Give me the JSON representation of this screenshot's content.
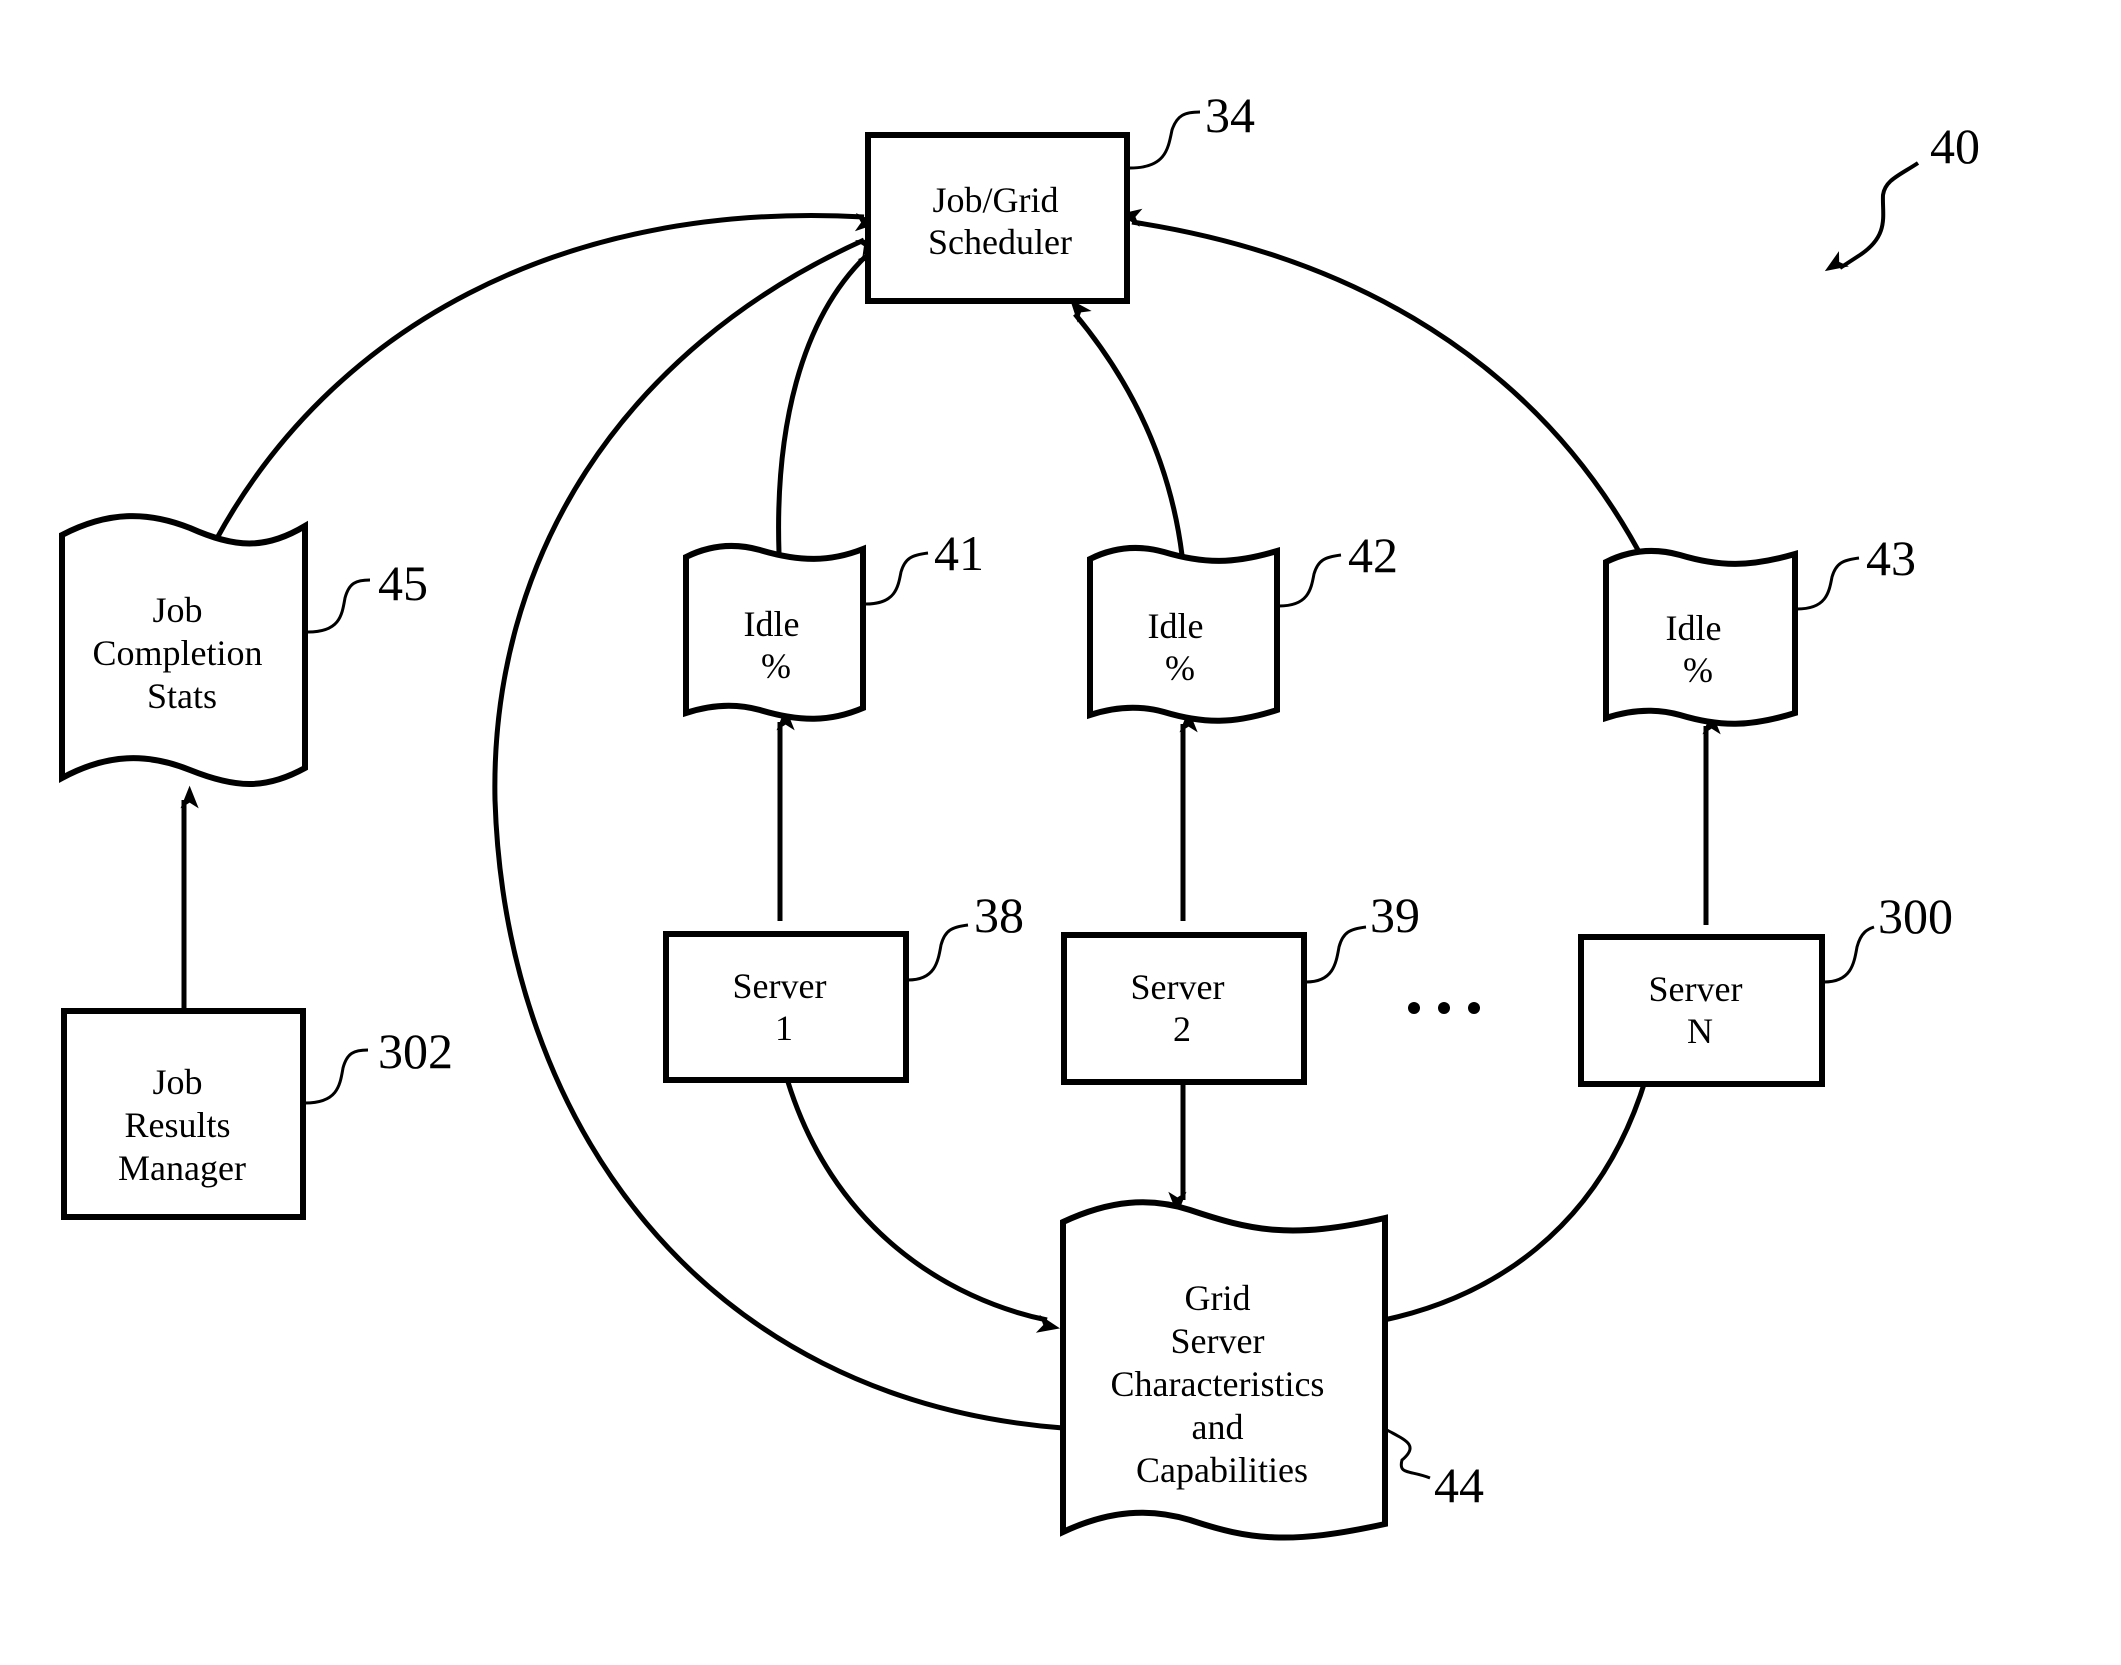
{
  "figure": {
    "reference": "40",
    "colors": {
      "line": "#000000",
      "background": "#ffffff"
    }
  },
  "nodes": {
    "scheduler": {
      "type": "process",
      "lines": [
        "Job/Grid",
        "Scheduler"
      ],
      "ref": "34"
    },
    "job_completion_stats": {
      "type": "document",
      "lines": [
        "Job",
        "Completion",
        "Stats"
      ],
      "ref": "45"
    },
    "job_results_manager": {
      "type": "process",
      "lines": [
        "Job",
        "Results",
        "Manager"
      ],
      "ref": "302"
    },
    "idle_1": {
      "type": "document",
      "lines": [
        "Idle",
        "%"
      ],
      "ref": "41"
    },
    "idle_2": {
      "type": "document",
      "lines": [
        "Idle",
        "%"
      ],
      "ref": "42"
    },
    "idle_n": {
      "type": "document",
      "lines": [
        "Idle",
        "%"
      ],
      "ref": "43"
    },
    "server_1": {
      "type": "process",
      "lines": [
        "Server",
        "1"
      ],
      "ref": "38"
    },
    "server_2": {
      "type": "process",
      "lines": [
        "Server",
        "2"
      ],
      "ref": "39"
    },
    "server_n": {
      "type": "process",
      "lines": [
        "Server",
        "N"
      ],
      "ref": "300"
    },
    "grid_server_characteristics": {
      "type": "document",
      "lines": [
        "Grid",
        "Server",
        "Characteristics",
        "and",
        "Capabilities"
      ],
      "ref": "44"
    }
  },
  "ellipsis": "...",
  "edges": [
    {
      "from": "job_results_manager",
      "to": "job_completion_stats"
    },
    {
      "from": "job_completion_stats",
      "to": "scheduler"
    },
    {
      "from": "grid_server_characteristics",
      "to": "scheduler"
    },
    {
      "from": "idle_1",
      "to": "scheduler"
    },
    {
      "from": "idle_2",
      "to": "scheduler"
    },
    {
      "from": "idle_n",
      "to": "scheduler"
    },
    {
      "from": "server_1",
      "to": "idle_1"
    },
    {
      "from": "server_2",
      "to": "idle_2"
    },
    {
      "from": "server_n",
      "to": "idle_n"
    },
    {
      "from": "server_1",
      "to": "grid_server_characteristics"
    },
    {
      "from": "server_2",
      "to": "grid_server_characteristics"
    },
    {
      "from": "server_n",
      "to": "grid_server_characteristics"
    }
  ]
}
